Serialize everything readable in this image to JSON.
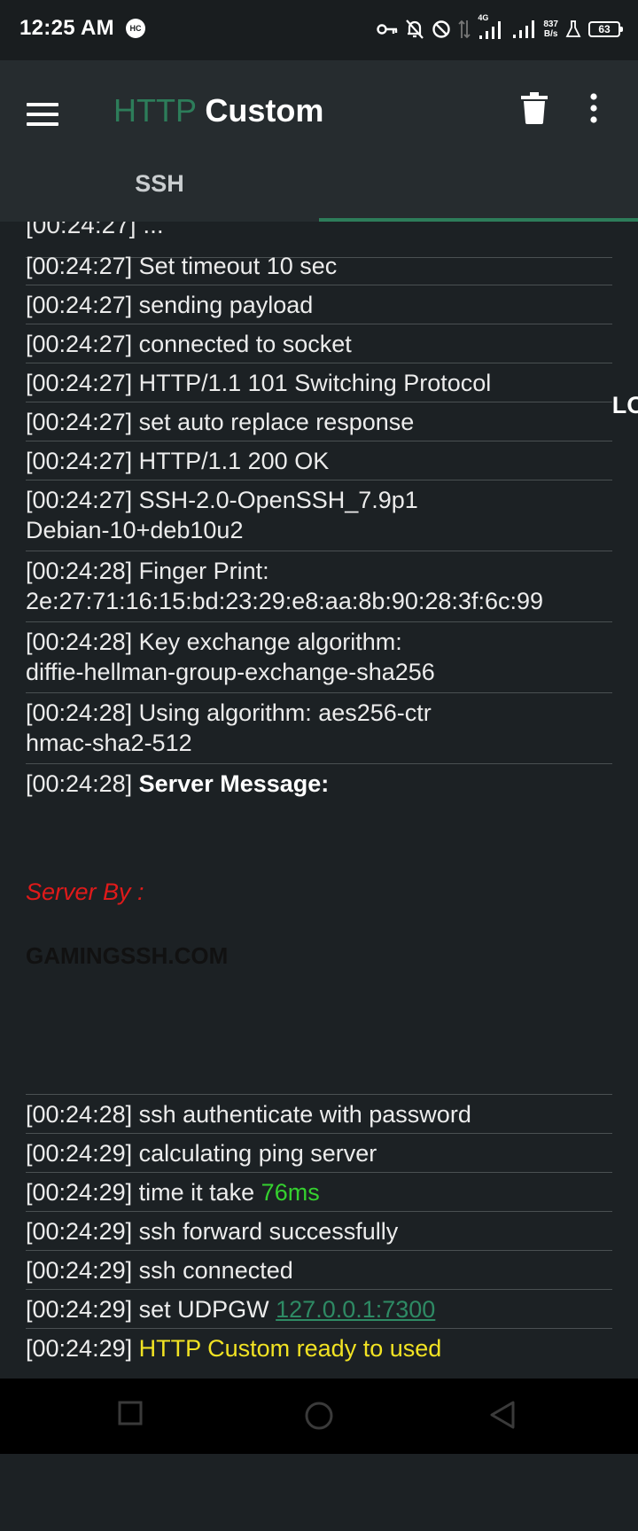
{
  "status_bar": {
    "time": "12:25 AM",
    "hc_badge": "HC",
    "network_type": "4G",
    "data_rate_value": "837",
    "data_rate_unit": "B/s",
    "battery": "63"
  },
  "app_bar": {
    "title_part1": "HTTP",
    "title_part2": "Custom",
    "tabs": [
      {
        "label": "SSH",
        "selected": false
      },
      {
        "label": "LOG",
        "selected": true
      }
    ],
    "accent_color": "#2d7d5a"
  },
  "log": {
    "entries": [
      {
        "time": "[00:24:27]",
        "text": "Set timeout 10 sec"
      },
      {
        "time": "[00:24:27]",
        "text": "sending payload"
      },
      {
        "time": "[00:24:27]",
        "text": "connected to socket"
      },
      {
        "time": "[00:24:27]",
        "text": "HTTP/1.1 101 Switching Protocol"
      },
      {
        "time": "[00:24:27]",
        "text": "set auto replace response"
      },
      {
        "time": "[00:24:27]",
        "text": "HTTP/1.1 200 OK"
      },
      {
        "time": "[00:24:27]",
        "text": "SSH-2.0-OpenSSH_7.9p1",
        "text2": "Debian-10+deb10u2"
      },
      {
        "time": "[00:24:28]",
        "text": "Finger Print:",
        "text2": "2e:27:71:16:15:bd:23:29:e8:aa:8b:90:28:3f:6c:99"
      },
      {
        "time": "[00:24:28]",
        "text": "Key exchange algorithm:",
        "text2": "diffie-hellman-group-exchange-sha256"
      },
      {
        "time": "[00:24:28]",
        "text": "Using algorithm: aes256-ctr",
        "text2": "hmac-sha2-512"
      },
      {
        "time": "[00:24:28]",
        "text": "Server Message:"
      }
    ],
    "server_message": {
      "line1": "Server By :",
      "line2": "GAMINGSSH.COM"
    },
    "entries_after": [
      {
        "time": "[00:24:28]",
        "text": "ssh authenticate with password"
      },
      {
        "time": "[00:24:29]",
        "text": "calculating ping server"
      },
      {
        "time": "[00:24:29]",
        "text": "time it take ",
        "highlight": "76ms"
      },
      {
        "time": "[00:24:29]",
        "text": "ssh forward successfully"
      },
      {
        "time": "[00:24:29]",
        "text": "ssh connected"
      },
      {
        "time": "[00:24:29]",
        "text": "set UDPGW ",
        "link": "127.0.0.1:7300"
      },
      {
        "time": "[00:24:29]",
        "highlight": "HTTP Custom ready to used"
      }
    ],
    "colors": {
      "success": "#35d12f",
      "link": "#2e8a64",
      "ready": "#f2e323",
      "server_by": "#e01a1a"
    }
  },
  "icons": {
    "menu": "menu-icon",
    "trash": "trash-icon",
    "more": "more-vert-icon",
    "nav_recent": "square-icon",
    "nav_home": "circle-icon",
    "nav_back": "triangle-back-icon"
  }
}
